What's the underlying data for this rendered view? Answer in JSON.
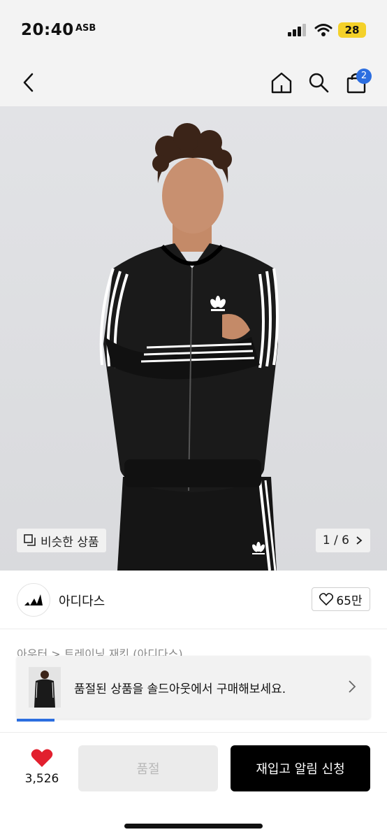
{
  "status_bar": {
    "time": "20:40",
    "carrier_badge": "ASB",
    "battery": "28",
    "battery_color": "#f4d12a"
  },
  "nav": {
    "icons": [
      "back-chevron-icon",
      "home-icon",
      "search-icon",
      "shopping-bag-icon"
    ],
    "cart_count": "2",
    "badge_color": "#2c6ee0"
  },
  "gallery": {
    "similar_label": "비슷한 상품",
    "page_indicator": "1 / 6"
  },
  "brand": {
    "name": "아디다스",
    "likes": "65만"
  },
  "breadcrumb": "아우터 > 트레이닝 재킷 (아디다스)",
  "soldout_banner": {
    "text": "품절된 상품을 솔드아웃에서 구매해보세요."
  },
  "bottom_bar": {
    "wish_count": "3,526",
    "soldout_label": "품절",
    "restock_label": "재입고 알림 신청",
    "heart_color": "#e2202e"
  }
}
